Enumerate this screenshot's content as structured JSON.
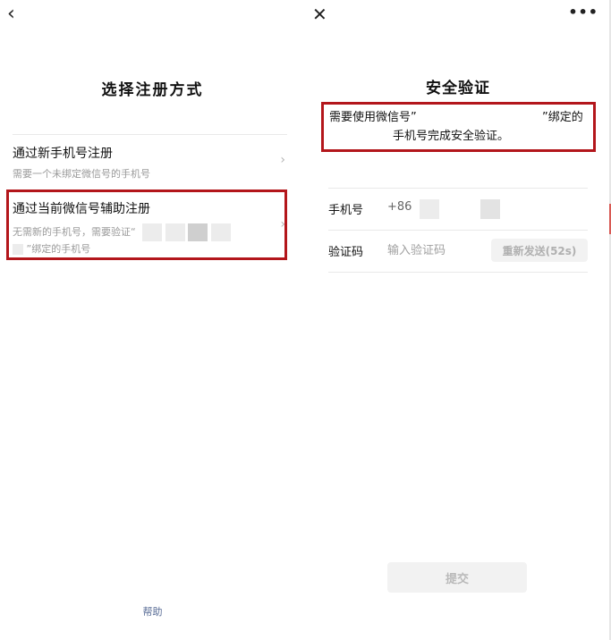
{
  "left_screen": {
    "back_glyph": "‹",
    "title": "选择注册方式",
    "options": [
      {
        "title": "通过新手机号注册",
        "desc": "需要一个未绑定微信号的手机号",
        "chevron": "›"
      },
      {
        "title": "通过当前微信号辅助注册",
        "desc_line1": "无需新的手机号，需要验证“",
        "desc_line2": "”绑定的手机号",
        "chevron": "›"
      }
    ],
    "help": "帮助"
  },
  "right_screen": {
    "close_glyph": "✕",
    "more_glyph": "•••",
    "title": "安全验证",
    "notice_line1_a": "需要使用微信号”",
    "notice_line1_b": "”绑定的",
    "notice_line2": "手机号完成安全验证。",
    "phone_label": "手机号",
    "phone_prefix": "+86",
    "code_label": "验证码",
    "code_placeholder": "输入验证码",
    "resend_label": "重新发送(52s)",
    "submit_label": "提交"
  },
  "colors": {
    "highlight": "#b3161b",
    "link": "#576b95",
    "muted_text": "#9a9a9a",
    "disabled_button_bg": "#f2f2f2"
  }
}
